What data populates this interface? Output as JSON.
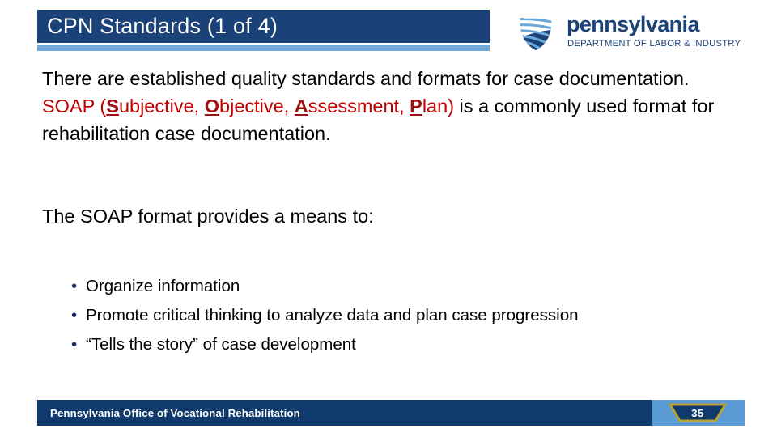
{
  "slide": {
    "title": "CPN Standards (1 of 4)",
    "accent_dark_blue": "#1b4278",
    "accent_light_blue": "#72a9dd",
    "accent_red": "#c00000",
    "bullet_color": "#1f2a66"
  },
  "logo": {
    "keystone_icon": "pennsylvania-keystone-icon",
    "name": "pennsylvania",
    "subtitle": "DEPARTMENT OF LABOR & INDUSTRY"
  },
  "body": {
    "intro": {
      "part1": "There are established quality standards and formats for case documentation. ",
      "soap_label": "SOAP",
      "open_paren": " (",
      "s_initial": "S",
      "s_rest": "ubjective, ",
      "o_initial": "O",
      "o_rest": "bjective, ",
      "a_initial": "A",
      "a_rest": "ssessment, ",
      "p_initial": "P",
      "p_rest": "lan)",
      "part2": " is a commonly used format for rehabilitation case documentation."
    },
    "means_heading": "The SOAP format provides a means to:",
    "bullet_glyph": "•",
    "bullets": [
      "Organize information",
      "Promote critical thinking to analyze data and plan case progression",
      "“Tells the story” of case development"
    ]
  },
  "footer": {
    "organization": "Pennsylvania Office of Vocational Rehabilitation",
    "page_number": "35",
    "badge_border_color": "#b8a230",
    "badge_fill_color": "#0f3a6b",
    "right_panel_color": "#5b9bd5"
  }
}
